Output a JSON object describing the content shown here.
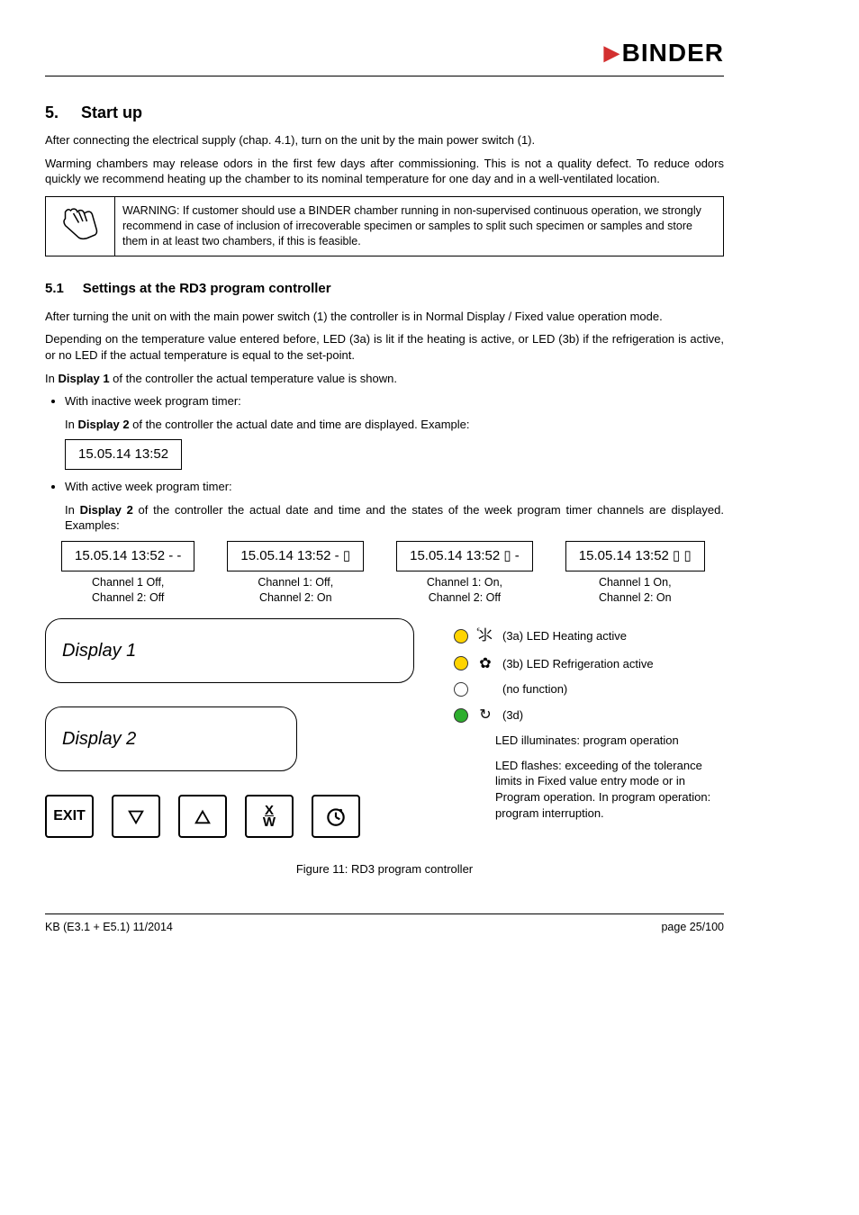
{
  "logo": {
    "text": "BINDER"
  },
  "section": {
    "num": "5.",
    "title": "Start up",
    "p1": "After connecting the electrical supply (chap. 4.1), turn on the unit by the main power switch (1).",
    "p2": "Warming chambers may release odors in the first few days after commissioning. This is not a quality defect. To reduce odors quickly we recommend heating up the chamber to its nominal temperature for one day and in a well-ventilated location."
  },
  "warning": "WARNING: If customer should use a BINDER chamber running in non-supervised continuous operation, we strongly recommend in case of inclusion of irrecoverable specimen or samples to split such specimen or samples and store them in at least two chambers, if this is feasible.",
  "sub": {
    "num": "5.1",
    "title": "Settings at the RD3 program controller",
    "p1": "After turning the unit on with the main power switch (1) the controller is in Normal Display / Fixed value operation mode.",
    "p2": "Depending on the temperature value entered before, LED (3a) is lit if the heating is active, or LED (3b) if the refrigeration is active, or no LED if the actual temperature is equal to the set-point.",
    "p3_pre": "In ",
    "p3_bold": "Display 1",
    "p3_post": " of the controller the actual temperature value is shown.",
    "b1": "With inactive week program timer:",
    "b1_sub_pre": "In ",
    "b1_sub_bold": "Display 2",
    "b1_sub_post": " of the controller the actual date and time are displayed. Example:",
    "b1_box": "15.05.14  13:52",
    "b2": "With active week program timer:",
    "b2_sub_pre": "In ",
    "b2_sub_bold": "Display 2",
    "b2_sub_post": " of the controller the actual date and time and the states of the week program timer channels are displayed. Examples:"
  },
  "examples": [
    {
      "box": "15.05.14  13:52 - -",
      "l1": "Channel 1 Off,",
      "l2": "Channel 2: Off"
    },
    {
      "box": "15.05.14  13:52 - ▯",
      "l1": "Channel 1: Off,",
      "l2": "Channel 2: On"
    },
    {
      "box": "15.05.14  13:52 ▯ -",
      "l1": "Channel 1: On,",
      "l2": "Channel 2: Off"
    },
    {
      "box": "15.05.14  13:52 ▯ ▯",
      "l1": "Channel 1 On,",
      "l2": "Channel 2: On"
    }
  ],
  "panel": {
    "display1": "Display 1",
    "display2": "Display 2",
    "btn_exit": "EXIT"
  },
  "leds": {
    "a": "(3a) LED Heating active",
    "b": "(3b) LED Refrigeration active",
    "c": "(no function)",
    "d": "(3d)",
    "d_note1": "LED illuminates: program operation",
    "d_note2": "LED flashes: exceeding of the tolerance limits in Fixed value entry mode or in Program operation. In program operation: program interruption."
  },
  "figure": "Figure 11: RD3 program controller",
  "footer": {
    "left": "KB (E3.1 + E5.1) 11/2014",
    "right": "page 25/100"
  }
}
